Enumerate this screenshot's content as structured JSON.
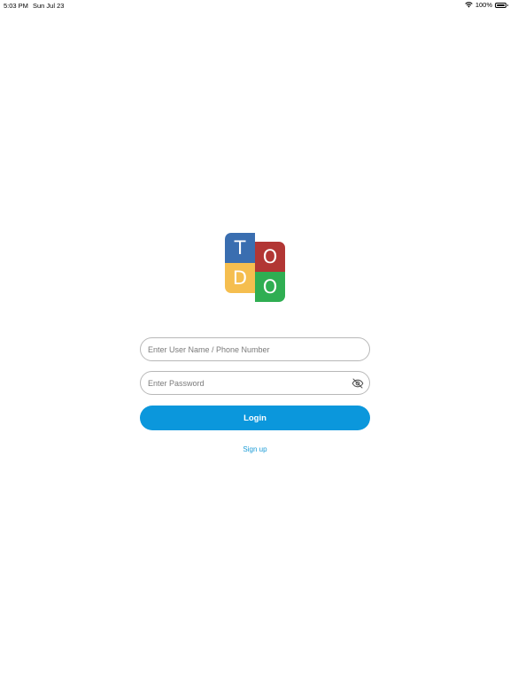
{
  "status_bar": {
    "time": "5:03 PM",
    "date": "Sun Jul 23",
    "battery": "100%",
    "icons": [
      "wifi-icon",
      "battery-icon"
    ]
  },
  "logo": {
    "letters": [
      "T",
      "O",
      "D",
      "O"
    ],
    "colors": [
      "#3a6eb0",
      "#b23634",
      "#f5be4f",
      "#2fae52"
    ]
  },
  "form": {
    "username_placeholder": "Enter User Name / Phone Number",
    "username_value": "",
    "password_placeholder": "Enter Password",
    "password_value": "",
    "password_toggle_icon": "eye-off-icon",
    "login_label": "Login",
    "signup_label": "Sign up"
  },
  "colors": {
    "accent": "#0b97dc",
    "link": "#1a9bd6"
  }
}
